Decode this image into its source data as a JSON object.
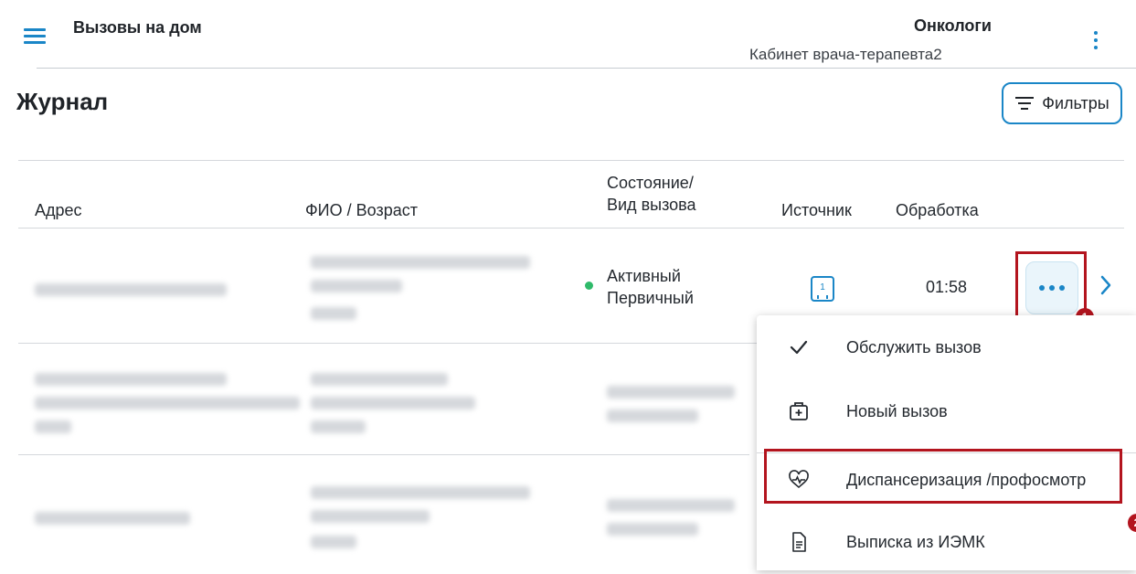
{
  "header": {
    "app_title": "Вызовы на дом",
    "organization": "Онкологи",
    "cabinet": "Кабинет врача-терапевта2"
  },
  "page": {
    "title": "Журнал",
    "filters_label": "Фильтры"
  },
  "table": {
    "columns": {
      "address": "Адрес",
      "fio": "ФИО / Возраст",
      "status_line1": "Состояние/",
      "status_line2": "Вид вызова",
      "source": "Источник",
      "processing": "Обработка"
    },
    "rows": [
      {
        "status": "Активный",
        "type": "Первичный",
        "processing": "01:58"
      }
    ]
  },
  "menu": {
    "items": [
      {
        "label": "Обслужить вызов",
        "icon": "check-icon"
      },
      {
        "label": "Новый вызов",
        "icon": "medical-case-icon"
      },
      {
        "label": "Диспансеризация /профосмотр",
        "icon": "heart-pulse-icon"
      },
      {
        "label": "Выписка из ИЭМК",
        "icon": "document-icon"
      }
    ]
  },
  "annotations": {
    "badge1": "1",
    "badge2": "2"
  },
  "colors": {
    "accent": "#1a86c7",
    "highlight": "#b3141e",
    "status_active": "#2fba6a"
  }
}
